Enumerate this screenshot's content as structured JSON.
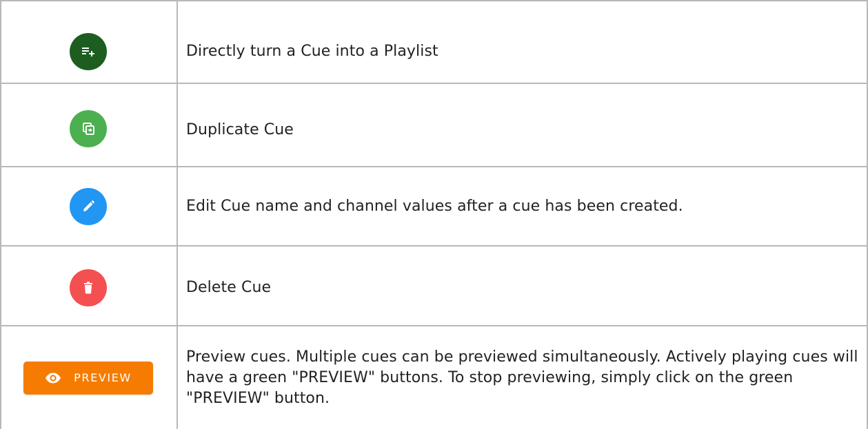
{
  "colors": {
    "playlist_button": "#1d5e20",
    "duplicate_button": "#4caf50",
    "edit_button": "#2196f3",
    "delete_button": "#f44f51",
    "preview_button": "#f57c00"
  },
  "rows": [
    {
      "icon": "playlist-add-icon",
      "description": "Directly turn a Cue into a Playlist"
    },
    {
      "icon": "duplicate-icon",
      "description": "Duplicate Cue"
    },
    {
      "icon": "pencil-icon",
      "description": "Edit Cue name and channel values after a cue has been created."
    },
    {
      "icon": "trash-icon",
      "description": "Delete Cue"
    },
    {
      "icon": "eye-icon",
      "button_label": "PREVIEW",
      "description": "Preview cues. Multiple cues can be previewed simultaneously. Actively playing cues will have a green \"PREVIEW\" buttons. To stop previewing, simply click on the green \"PREVIEW\" button."
    }
  ]
}
